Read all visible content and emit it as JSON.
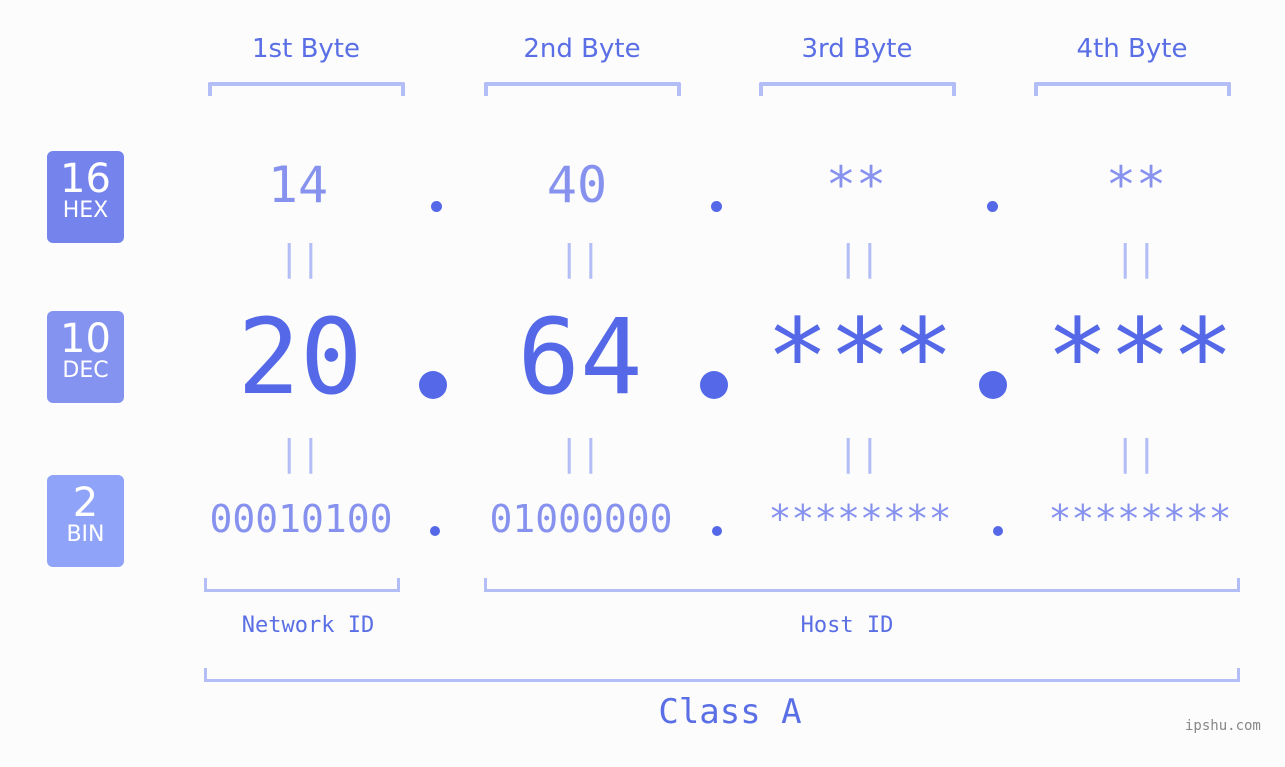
{
  "headers": [
    "1st Byte",
    "2nd Byte",
    "3rd Byte",
    "4th Byte"
  ],
  "badges": {
    "hex": {
      "number": "16",
      "label": "HEX",
      "color": "#7584ec"
    },
    "dec": {
      "number": "10",
      "label": "DEC",
      "color": "#8593f0"
    },
    "bin": {
      "number": "2",
      "label": "BIN",
      "color": "#8fa3f8"
    }
  },
  "hex": [
    "14",
    "40",
    "**",
    "**"
  ],
  "dec": [
    "20",
    "64",
    "***",
    "***"
  ],
  "bin": [
    "00010100",
    "01000000",
    "********",
    "********"
  ],
  "equals_sign": "||",
  "labels": {
    "network_id": "Network ID",
    "host_id": "Host ID",
    "class": "Class A"
  },
  "watermark": "ipshu.com",
  "colors": {
    "accent": "#5468e8",
    "light": "#8692ee",
    "bracket": "#b3bdf6"
  }
}
